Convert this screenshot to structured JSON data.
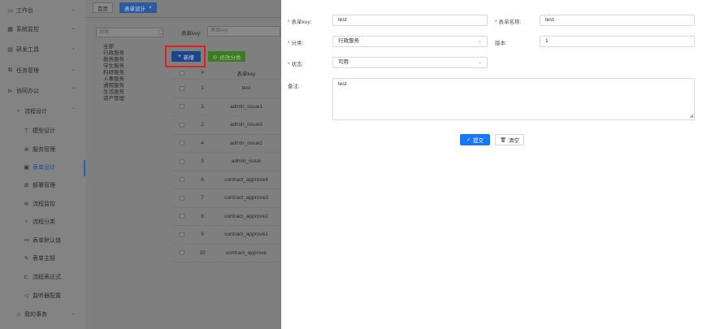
{
  "sidebar": {
    "items": [
      {
        "label": "工作台",
        "icon": "monitor-icon",
        "level": 0,
        "chevron": "⌄"
      },
      {
        "label": "系统监控",
        "icon": "dashboard-icon",
        "level": 0,
        "chevron": "⌄"
      },
      {
        "label": "研发工具",
        "icon": "toolbox-icon",
        "level": 0,
        "chevron": "⌄"
      },
      {
        "label": "任务管理",
        "icon": "task-icon",
        "level": 0,
        "chevron": "⌄"
      },
      {
        "label": "协同办公",
        "icon": "cooperation-icon",
        "level": 0,
        "chevron": "⌃"
      },
      {
        "label": "流程设计",
        "icon": "flow-icon",
        "level": 1,
        "chevron": "⌃"
      },
      {
        "label": "模型设计",
        "icon": "model-icon",
        "level": 2
      },
      {
        "label": "服务管理",
        "icon": "service-icon",
        "level": 2
      },
      {
        "label": "表单设计",
        "icon": "form-icon",
        "level": 2,
        "active": true
      },
      {
        "label": "部署管理",
        "icon": "deploy-icon",
        "level": 2
      },
      {
        "label": "流程监控",
        "icon": "monitor-flow-icon",
        "level": 2
      },
      {
        "label": "流程分类",
        "icon": "category-icon",
        "level": 2
      },
      {
        "label": "表单默认值",
        "icon": "link-icon",
        "level": 2
      },
      {
        "label": "表单主题",
        "icon": "theme-icon",
        "level": 2
      },
      {
        "label": "流程表达式",
        "icon": "expression-icon",
        "level": 2
      },
      {
        "label": "监听器配置",
        "icon": "listener-icon",
        "level": 2
      },
      {
        "label": "我的事务",
        "icon": "bell-icon",
        "level": 1,
        "chevron": "⌄"
      }
    ]
  },
  "topnav": {
    "tabs": [
      {
        "label": "首页",
        "active": false
      },
      {
        "label": "表单设计",
        "active": true,
        "close": "×"
      }
    ]
  },
  "category": {
    "search_placeholder": "搜索",
    "items": [
      "全部",
      "行政服务",
      "教务服务",
      "学生服务",
      "科研服务",
      "人事服务",
      "通用服务",
      "生活服务",
      "资产管理"
    ]
  },
  "filter": {
    "key_label": "表单key:",
    "key_placeholder": "表单key"
  },
  "toolbar": {
    "add_label": "新增",
    "add_icon": "+",
    "edit_label": "修改分类",
    "edit_icon": "◎"
  },
  "table": {
    "header_num": "#",
    "header_key": "表单key",
    "rows": [
      {
        "num": "1",
        "key": "test"
      },
      {
        "num": "3",
        "key": "admin_issue1"
      },
      {
        "num": "2",
        "key": "admin_issue3"
      },
      {
        "num": "4",
        "key": "admin_issue2"
      },
      {
        "num": "5",
        "key": "admin_issue"
      },
      {
        "num": "6",
        "key": "contract_approve4"
      },
      {
        "num": "7",
        "key": "contract_approve3"
      },
      {
        "num": "8",
        "key": "contract_approve2"
      },
      {
        "num": "9",
        "key": "contract_approve1"
      },
      {
        "num": "10",
        "key": "contract_approve"
      }
    ]
  },
  "form": {
    "key_label": "表单key:",
    "key_value": "test",
    "name_label": "表单名称:",
    "name_value": "test",
    "category_label": "分类:",
    "category_value": "行政服务",
    "version_label": "版本:",
    "version_value": "1",
    "status_label": "状态:",
    "status_value": "可用",
    "remark_label": "备注:",
    "remark_value": "test",
    "required_mark": "*",
    "select_arrow": "⌄",
    "submit_label": "提交",
    "submit_icon": "✓",
    "clear_label": "清空",
    "clear_icon": "🗑"
  }
}
